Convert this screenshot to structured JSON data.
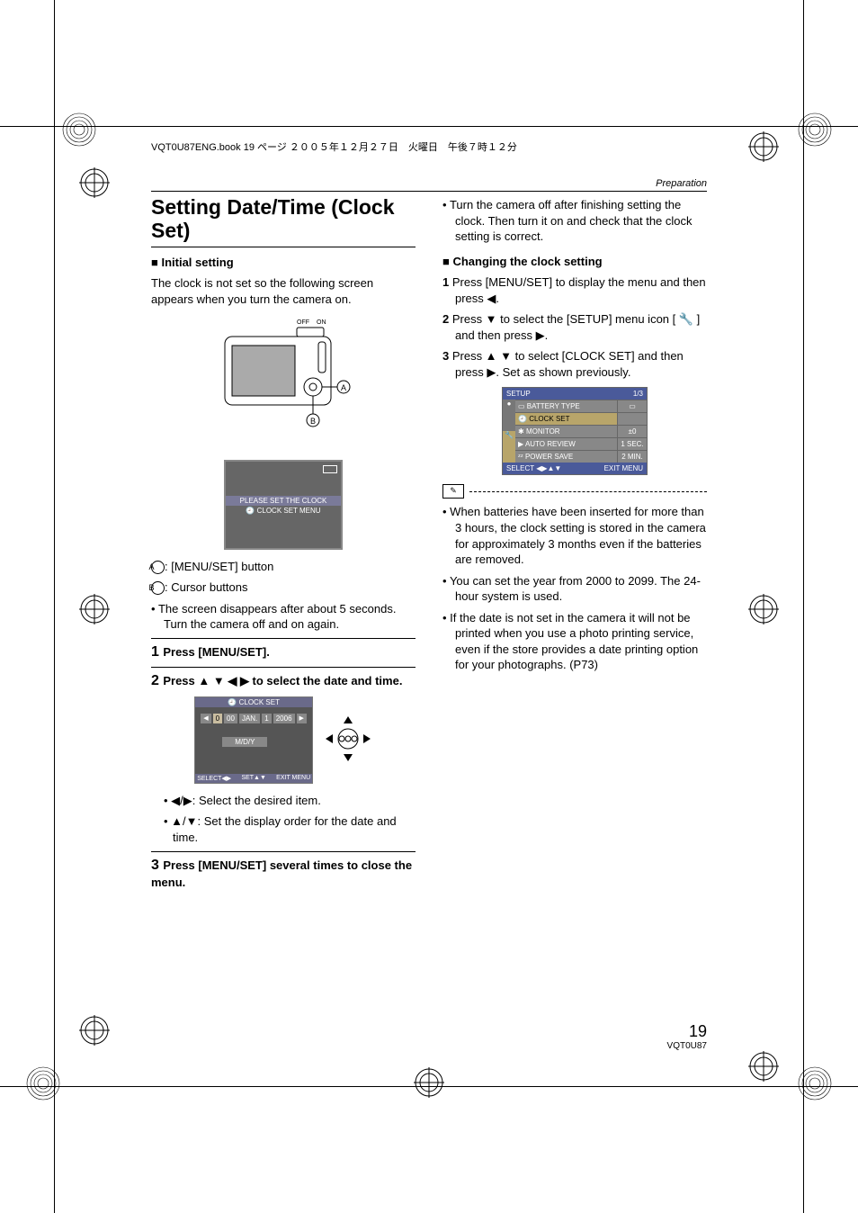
{
  "header_runner": "VQT0U87ENG.book  19 ページ  ２００５年１２月２７日　火曜日　午後７時１２分",
  "section_tag": "Preparation",
  "title": "Setting Date/Time (Clock Set)",
  "initial_setting_head": "■ Initial setting",
  "initial_setting_body": "The clock is not set so the following screen appears when you turn the camera on.",
  "off_on": "OFF ON",
  "lcd1_msg": "PLEASE SET THE CLOCK",
  "lcd1_sub": "🕘 CLOCK SET  MENU",
  "label_A": ": [MENU/SET] button",
  "label_B": ": Cursor buttons",
  "bullet_screen_disappears": "The screen disappears after about 5 seconds. Turn the camera off and on again.",
  "step1": "Press [MENU/SET].",
  "step2": "Press ▲ ▼ ◀ ▶ to select the date and time.",
  "clockset_title": "🕘 CLOCK SET",
  "clockset_fields": {
    "h": "0",
    "m": "00",
    "mon": "JAN.",
    "d": "1",
    "y": "2006"
  },
  "clockset_mdy": "M/D/Y",
  "clockset_foot_select": "SELECT◀▶",
  "clockset_foot_set": "SET▲▼",
  "clockset_foot_exit": "EXIT MENU",
  "step2_sub1": "◀/▶: Select the desired item.",
  "step2_sub2": "▲/▼: Set the display order for the date and time.",
  "step3": "Press [MENU/SET] several times to close the menu.",
  "bullet_turn_off": "Turn the camera off after finishing setting the clock. Then turn it on and check that the clock setting is correct.",
  "changing_head": "■ Changing the clock setting",
  "chg1": "Press [MENU/SET] to display the menu and then press ◀.",
  "chg2": "Press ▼ to select the [SETUP] menu icon [ 🔧 ] and then press ▶.",
  "chg3": "Press ▲ ▼ to select [CLOCK SET] and then press ▶. Set as shown previously.",
  "setup": {
    "head_left": "SETUP",
    "head_right": "1/3",
    "rows": [
      {
        "lbl": "BATTERY TYPE",
        "val": "▭"
      },
      {
        "lbl": "CLOCK SET",
        "val": "",
        "sel": true
      },
      {
        "lbl": "MONITOR",
        "val": "±0"
      },
      {
        "lbl": "AUTO REVIEW",
        "val": "1 SEC."
      },
      {
        "lbl": "POWER SAVE",
        "val": "2 MIN."
      }
    ],
    "foot_left": "SELECT ◀▶▲▼",
    "foot_right": "EXIT MENU"
  },
  "note1": "When batteries have been inserted for more than 3 hours, the clock setting is stored in the camera for approximately 3 months even if the batteries are removed.",
  "note2": "You can set the year from 2000 to 2099. The 24-hour system is used.",
  "note3": "If the date is not set in the camera it will not be printed when you use a photo printing service, even if the store provides a date printing option for your photographs. (P73)",
  "page_number": "19",
  "page_code": "VQT0U87"
}
